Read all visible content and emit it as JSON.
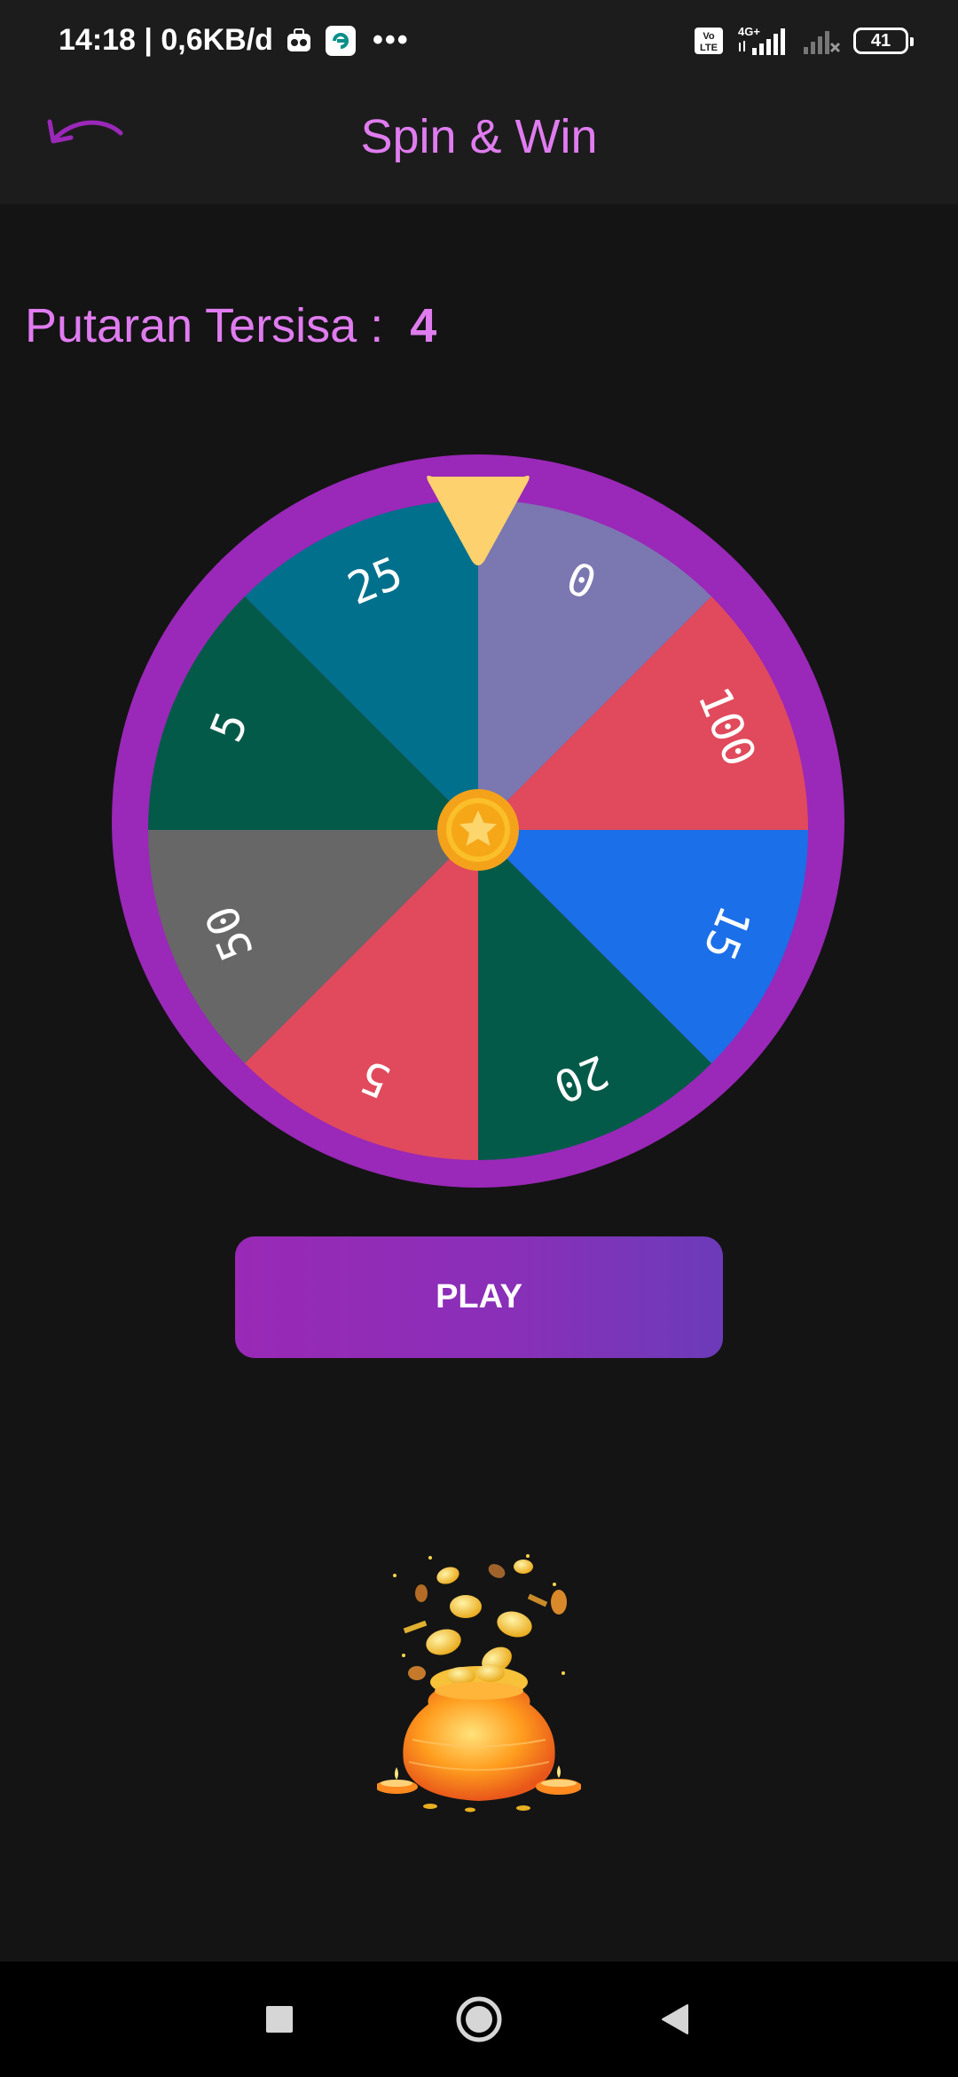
{
  "status_bar": {
    "time_and_speed": "14:18 | 0,6KB/d",
    "more_indicator": "•••",
    "volte_label": "Vo LTE",
    "network_label": "4G+",
    "battery_level": "41",
    "icons": [
      "notification-app-icon",
      "app-notification-icon",
      "volte-icon",
      "signal-4g-icon",
      "signal-weak-icon",
      "battery-icon"
    ]
  },
  "app_bar": {
    "title": "Spin & Win",
    "back_icon": "curved-back-arrow-icon"
  },
  "spins": {
    "label": "Putaran Tersisa :",
    "value": "4"
  },
  "wheel": {
    "segments": [
      {
        "label": "0",
        "color": "#7b77b0"
      },
      {
        "label": "100",
        "color": "#e04a5c"
      },
      {
        "label": "15",
        "color": "#1b6fe8"
      },
      {
        "label": "20",
        "color": "#045a48"
      },
      {
        "label": "5",
        "color": "#e04a5c"
      },
      {
        "label": "50",
        "color": "#676767"
      },
      {
        "label": "5",
        "color": "#045a48"
      },
      {
        "label": "25",
        "color": "#00708c"
      }
    ],
    "rim_color": "#9a28b8",
    "pointer_color": "#fcd16e",
    "center_icon": "star-coin-icon"
  },
  "play_button": {
    "label": "PLAY"
  },
  "illustration": {
    "icon": "gold-coin-pot-icon"
  },
  "nav": {
    "recents_icon": "square-icon",
    "home_icon": "circle-home-icon",
    "back_icon": "triangle-back-icon"
  },
  "colors": {
    "accent": "#e07cf0",
    "background": "#141414",
    "bar_background": "#1c1c1c"
  }
}
